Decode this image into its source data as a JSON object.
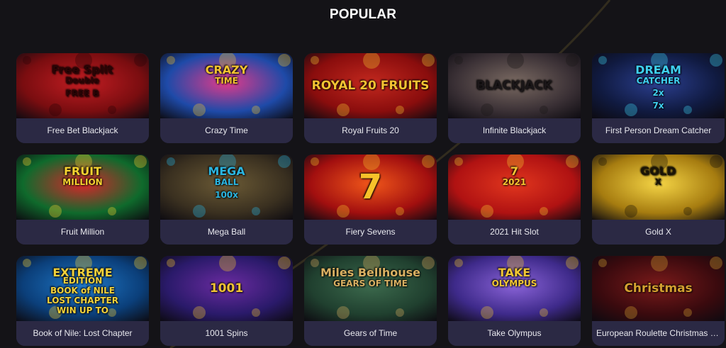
{
  "section": {
    "title": "POPULAR"
  },
  "games": [
    {
      "name": "Free Bet Blackjack",
      "art_text": [
        "Free Split",
        "Double",
        "FREE B"
      ],
      "colors": [
        "#7a0d10",
        "#c21d22",
        "#2b0405"
      ]
    },
    {
      "name": "Crazy Time",
      "art_text": [
        "CRAZY",
        "TIME"
      ],
      "colors": [
        "#1e4aa8",
        "#e23a8a",
        "#f2c230"
      ]
    },
    {
      "name": "Royal Fruits 20",
      "art_text": [
        "ROYAL 20 FRUITS"
      ],
      "colors": [
        "#8a0d0d",
        "#c2281e",
        "#f3c232"
      ]
    },
    {
      "name": "Infinite Blackjack",
      "art_text": [
        "BLACKJACK"
      ],
      "colors": [
        "#3a3035",
        "#7a6a62",
        "#1a1618"
      ]
    },
    {
      "name": "First Person Dream Catcher",
      "art_text": [
        "DREAM",
        "CATCHER",
        "2x",
        "7x"
      ],
      "colors": [
        "#101a40",
        "#2b3f90",
        "#3fd0f0"
      ]
    },
    {
      "name": "Fruit Million",
      "art_text": [
        "FRUIT",
        "MILLION"
      ],
      "colors": [
        "#0f6a2c",
        "#d8262a",
        "#f5d130"
      ]
    },
    {
      "name": "Mega Ball",
      "art_text": [
        "MEGA",
        "BALL",
        "100x"
      ],
      "colors": [
        "#3a3020",
        "#6b5a35",
        "#2bb5e0"
      ]
    },
    {
      "name": "Fiery Sevens",
      "art_text": [
        "7"
      ],
      "colors": [
        "#a20f0f",
        "#f0561a",
        "#f7c12a"
      ]
    },
    {
      "name": "2021 Hit Slot",
      "art_text": [
        "7",
        "2021"
      ],
      "colors": [
        "#b01212",
        "#e1361e",
        "#f6c531"
      ]
    },
    {
      "name": "Gold X",
      "art_text": [
        "GOLD",
        "X"
      ],
      "colors": [
        "#a67c10",
        "#f4d445",
        "#1a1406"
      ]
    },
    {
      "name": "Book of Nile: Lost Chapter",
      "art_text": [
        "EXTREME",
        "EDITION",
        "BOOK of NILE",
        "LOST CHAPTER",
        "WIN UP TO"
      ],
      "colors": [
        "#0b3f7a",
        "#1f78c8",
        "#f3d13a"
      ]
    },
    {
      "name": "1001 Spins",
      "art_text": [
        "1001"
      ],
      "colors": [
        "#2a1a6a",
        "#6a2ba0",
        "#f0c234"
      ]
    },
    {
      "name": "Gears of Time",
      "art_text": [
        "Miles Bellhouse",
        "GEARS OF TIME"
      ],
      "colors": [
        "#20402f",
        "#3c6a4d",
        "#d9b062"
      ]
    },
    {
      "name": "Take Olympus",
      "art_text": [
        "TAKE",
        "OLYMPUS"
      ],
      "colors": [
        "#3e2a8a",
        "#8a63d8",
        "#f2c634"
      ]
    },
    {
      "name": "European Roulette Christmas Edition",
      "art_text": [
        "Christmas"
      ],
      "colors": [
        "#3a0a0e",
        "#7a1a1a",
        "#d4a030"
      ]
    }
  ]
}
